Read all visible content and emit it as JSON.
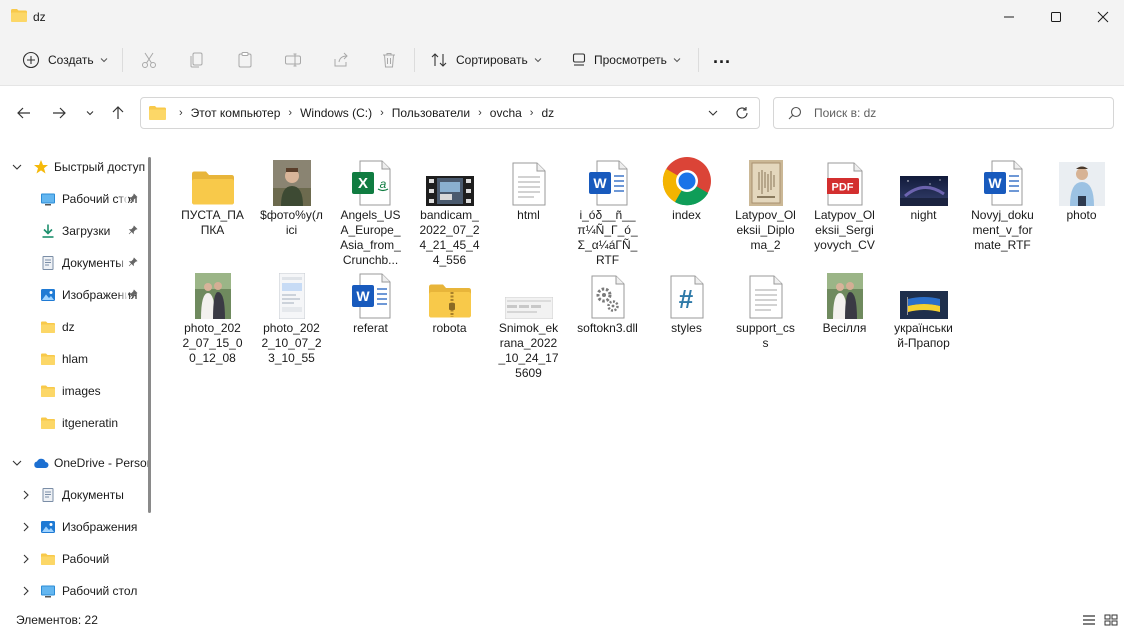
{
  "window": {
    "title": "dz"
  },
  "toolbar": {
    "create_label": "Создать",
    "sort_label": "Сортировать",
    "view_label": "Просмотреть",
    "more_label": "..."
  },
  "address": {
    "crumbs": [
      "Этот компьютер",
      "Windows (C:)",
      "Пользователи",
      "ovcha",
      "dz"
    ]
  },
  "search": {
    "placeholder": "Поиск в: dz"
  },
  "sidebar": {
    "items": [
      {
        "label": "Быстрый доступ",
        "icon": "star-icon"
      },
      {
        "label": "Рабочий стол",
        "icon": "desktop-icon"
      },
      {
        "label": "Загрузки",
        "icon": "download-icon"
      },
      {
        "label": "Документы",
        "icon": "documents-icon"
      },
      {
        "label": "Изображения",
        "icon": "pictures-icon"
      },
      {
        "label": "dz",
        "icon": "folder-icon"
      },
      {
        "label": "hlam",
        "icon": "folder-icon"
      },
      {
        "label": "images",
        "icon": "folder-icon"
      },
      {
        "label": "itgeneratin",
        "icon": "folder-icon"
      },
      {
        "label": "OneDrive - Personal",
        "icon": "cloud-icon"
      },
      {
        "label": "Документы",
        "icon": "documents-icon"
      },
      {
        "label": "Изображения",
        "icon": "pictures-icon"
      },
      {
        "label": "Рабочий",
        "icon": "folder-icon"
      },
      {
        "label": "Рабочий стол",
        "icon": "desktop-icon"
      }
    ]
  },
  "files": [
    {
      "name": "ПУСТА_ПАПКА",
      "type": "folder"
    },
    {
      "name": "$фото%у(лісі",
      "type": "photo"
    },
    {
      "name": "Angels_USA_Europe_Asia_from_Crunchb...",
      "type": "excel"
    },
    {
      "name": "bandicam_2022_07_24_21_45_44_556",
      "type": "video"
    },
    {
      "name": "html",
      "type": "text"
    },
    {
      "name": "і_óδ__ñ__π¼Ñ_Γ_ó_Σ_α¼áΓÑ_RTF",
      "type": "word"
    },
    {
      "name": "index",
      "type": "chrome"
    },
    {
      "name": "Latypov_Oleksii_Diploma_2",
      "type": "diploma"
    },
    {
      "name": "Latypov_Oleksii_Sergiyovych_CV",
      "type": "pdf"
    },
    {
      "name": "night",
      "type": "night"
    },
    {
      "name": "Novyj_dokument_v_formate_RTF",
      "type": "word"
    },
    {
      "name": "photo",
      "type": "person"
    },
    {
      "name": "photo_2022_07_15_00_12_08",
      "type": "wedding"
    },
    {
      "name": "photo_2022_10_07_23_10_55",
      "type": "phone"
    },
    {
      "name": "referat",
      "type": "word"
    },
    {
      "name": "robota",
      "type": "zip"
    },
    {
      "name": "Snimok_ekrana_2022_10_24_175609",
      "type": "screenshot"
    },
    {
      "name": "softokn3.dll",
      "type": "dll"
    },
    {
      "name": "styles",
      "type": "css"
    },
    {
      "name": "support_css",
      "type": "text"
    },
    {
      "name": "Весілля",
      "type": "wedding"
    },
    {
      "name": "український-Прапор",
      "type": "flag"
    }
  ],
  "status": {
    "count": "Элементов: 22"
  },
  "colors": {
    "folder": "#f8c94a",
    "accent": "#0067c0",
    "excel": "#107c41",
    "word": "#185abd",
    "pdf": "#d32f2f"
  }
}
